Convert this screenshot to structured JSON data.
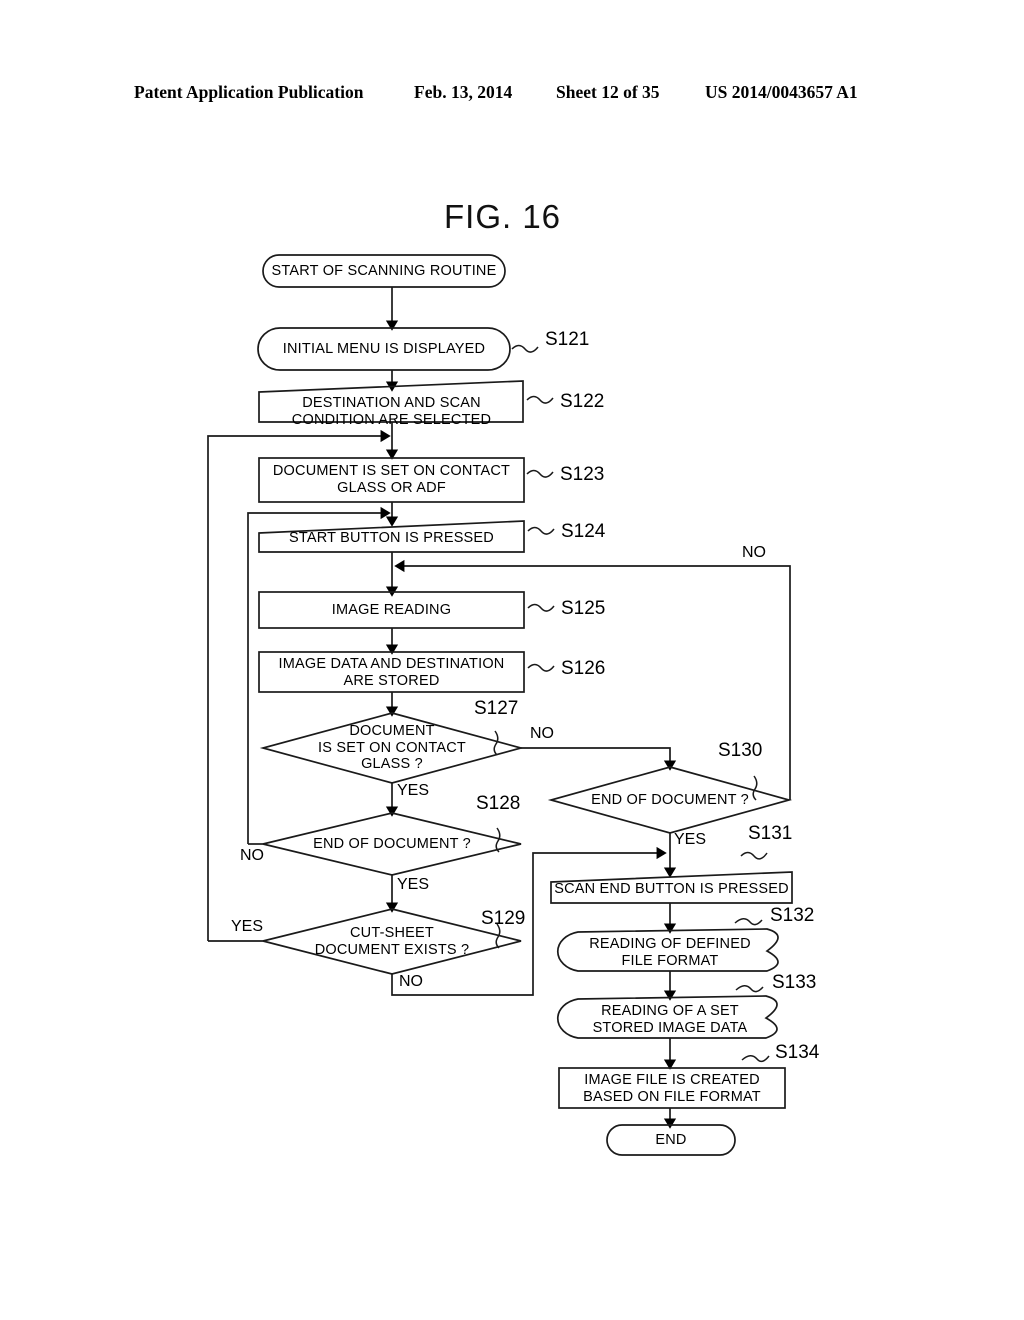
{
  "header": {
    "publication": "Patent Application Publication",
    "date": "Feb. 13, 2014",
    "sheet": "Sheet 12 of 35",
    "number": "US 2014/0043657 A1"
  },
  "figure": {
    "title": "FIG. 16"
  },
  "nodes": {
    "start": "START OF SCANNING ROUTINE",
    "s121": {
      "line1": "INITIAL MENU IS DISPLAYED"
    },
    "s122": {
      "line1": "DESTINATION AND SCAN",
      "line2": "CONDITION ARE SELECTED"
    },
    "s123": {
      "line1": "DOCUMENT IS SET ON CONTACT",
      "line2": "GLASS OR ADF"
    },
    "s124": {
      "line1": "START BUTTON IS PRESSED"
    },
    "s125": {
      "line1": "IMAGE READING"
    },
    "s126": {
      "line1": "IMAGE DATA AND DESTINATION",
      "line2": "ARE STORED"
    },
    "s127": {
      "line1": "DOCUMENT",
      "line2": "IS SET ON CONTACT",
      "line3": "GLASS ?"
    },
    "s128": {
      "line1": "END OF DOCUMENT ?"
    },
    "s129": {
      "line1": "CUT-SHEET",
      "line2": "DOCUMENT EXISTS ?"
    },
    "s130": {
      "line1": "END OF DOCUMENT ?"
    },
    "s131": {
      "line1": "SCAN END BUTTON IS PRESSED"
    },
    "s132": {
      "line1": "READING OF DEFINED",
      "line2": "FILE FORMAT"
    },
    "s133": {
      "line1": "READING OF A SET",
      "line2": "STORED IMAGE DATA"
    },
    "s134": {
      "line1": "IMAGE FILE IS CREATED",
      "line2": "BASED ON FILE FORMAT"
    },
    "end": "END"
  },
  "step_labels": {
    "s121": "S121",
    "s122": "S122",
    "s123": "S123",
    "s124": "S124",
    "s125": "S125",
    "s126": "S126",
    "s127": "S127",
    "s128": "S128",
    "s129": "S129",
    "s130": "S130",
    "s131": "S131",
    "s132": "S132",
    "s133": "S133",
    "s134": "S134"
  },
  "edge_labels": {
    "s130_no": "NO",
    "s127_no": "NO",
    "s127_yes": "YES",
    "s128_no": "NO",
    "s128_yes": "YES",
    "s129_yes": "YES",
    "s129_no": "NO",
    "s130_yes": "YES"
  },
  "colors": {
    "ink": "#000000",
    "paper": "#ffffff"
  }
}
